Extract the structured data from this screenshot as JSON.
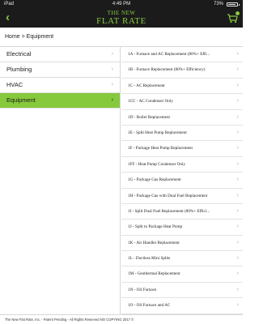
{
  "status": {
    "carrier": "iPad",
    "time": "4:49 PM",
    "battery": "73%",
    "battery_level": 0.73
  },
  "header": {
    "logo_line1": "THE NEW",
    "logo_line2": "FLAT RATE",
    "accent_color": "#86c93c",
    "back_icon": "chevron-left-icon",
    "cart_icon": "cart-icon"
  },
  "breadcrumb": "Home > Equipment",
  "sidebar": {
    "items": [
      {
        "label": "Electrical"
      },
      {
        "label": "Plumbing"
      },
      {
        "label": "HVAC"
      },
      {
        "label": "Equipment"
      }
    ],
    "active_index": 3
  },
  "list": {
    "items": [
      {
        "label": "1A - Furnace and AC Replacement (80%+ Effi..."
      },
      {
        "label": "1B - Furnace Replacement (80%+ Efficiency)"
      },
      {
        "label": "1C - AC Replacement"
      },
      {
        "label": "1CC - AC Condenser Only"
      },
      {
        "label": "1D - Boiler Replacement"
      },
      {
        "label": "1E - Split Heat Pump Replacement"
      },
      {
        "label": "1F - Package Heat Pump Replacement"
      },
      {
        "label": "1FF - Heat Pump Condenser Only"
      },
      {
        "label": "1G - Package Gas Replacement"
      },
      {
        "label": "1H - Package Gas with Dual Fuel Replacement"
      },
      {
        "label": "1I - Split Dual Fuel Replacement (80%+ Effici..."
      },
      {
        "label": "1J - Split to Package Heat Pump"
      },
      {
        "label": "1K - Air Handler Replacement"
      },
      {
        "label": "1L - Ductless Mini Splits"
      },
      {
        "label": "1M - Geothermal Replacement"
      },
      {
        "label": "1N - Oil Furnace"
      },
      {
        "label": "1O - Oil Furnace and AC"
      }
    ]
  },
  "footer": "The New Flat Rate, Inc. - Patent Pending - All Rights Reserved NO COPYING 2017 ©"
}
